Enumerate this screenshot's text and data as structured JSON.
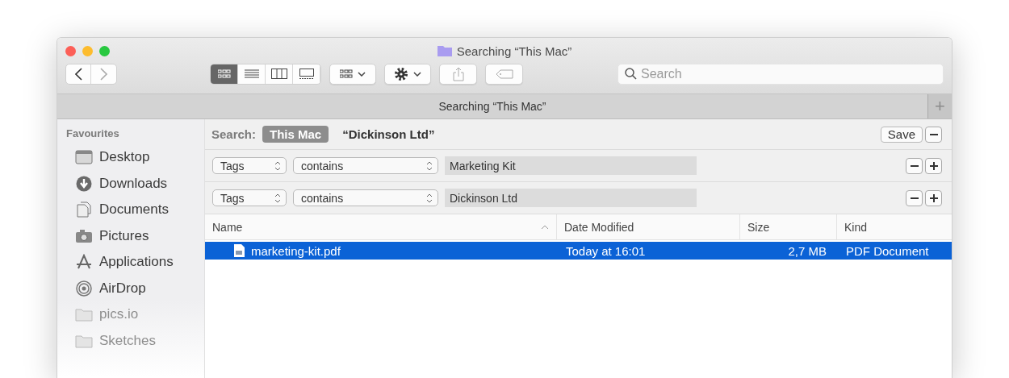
{
  "window": {
    "title": "Searching “This Mac”"
  },
  "toolbar": {
    "views": [
      {
        "kind": "icons",
        "selected": true
      },
      {
        "kind": "list",
        "selected": false
      },
      {
        "kind": "columns",
        "selected": false
      },
      {
        "kind": "gallery",
        "selected": false
      }
    ],
    "search": {
      "placeholder": "Search"
    }
  },
  "tab_bar": {
    "tabs": [
      {
        "label": "Searching “This Mac”",
        "selected": true
      }
    ],
    "add": "+"
  },
  "sidebar": {
    "heading": "Favourites",
    "items": [
      {
        "label": "Desktop",
        "kind": "desktop",
        "dimmed": false
      },
      {
        "label": "Downloads",
        "kind": "downloads",
        "dimmed": false
      },
      {
        "label": "Documents",
        "kind": "documents",
        "dimmed": false
      },
      {
        "label": "Pictures",
        "kind": "pictures",
        "dimmed": false
      },
      {
        "label": "Applications",
        "kind": "applications",
        "dimmed": false
      },
      {
        "label": "AirDrop",
        "kind": "airdrop",
        "dimmed": false
      },
      {
        "label": "pics.io",
        "kind": "folder",
        "dimmed": true
      },
      {
        "label": "Sketches",
        "kind": "folder",
        "dimmed": true
      }
    ]
  },
  "search_bar": {
    "label": "Search:",
    "scopes": [
      {
        "label": "This Mac",
        "selected": true
      },
      {
        "label": "“Dickinson Ltd”",
        "selected": false
      }
    ],
    "save": "Save"
  },
  "criteria": [
    {
      "attribute": "Tags",
      "operator": "contains",
      "value": "Marketing Kit"
    },
    {
      "attribute": "Tags",
      "operator": "contains",
      "value": "Dickinson Ltd"
    }
  ],
  "table": {
    "columns": [
      {
        "label": "Name",
        "sorted": true
      },
      {
        "label": "Date Modified",
        "sorted": false
      },
      {
        "label": "Size",
        "sorted": false
      },
      {
        "label": "Kind",
        "sorted": false
      }
    ],
    "rows": [
      {
        "name": "marketing-kit.pdf",
        "date_modified": "Today at 16:01",
        "size": "2,7 MB",
        "kind": "PDF Document",
        "selected": true
      }
    ]
  }
}
